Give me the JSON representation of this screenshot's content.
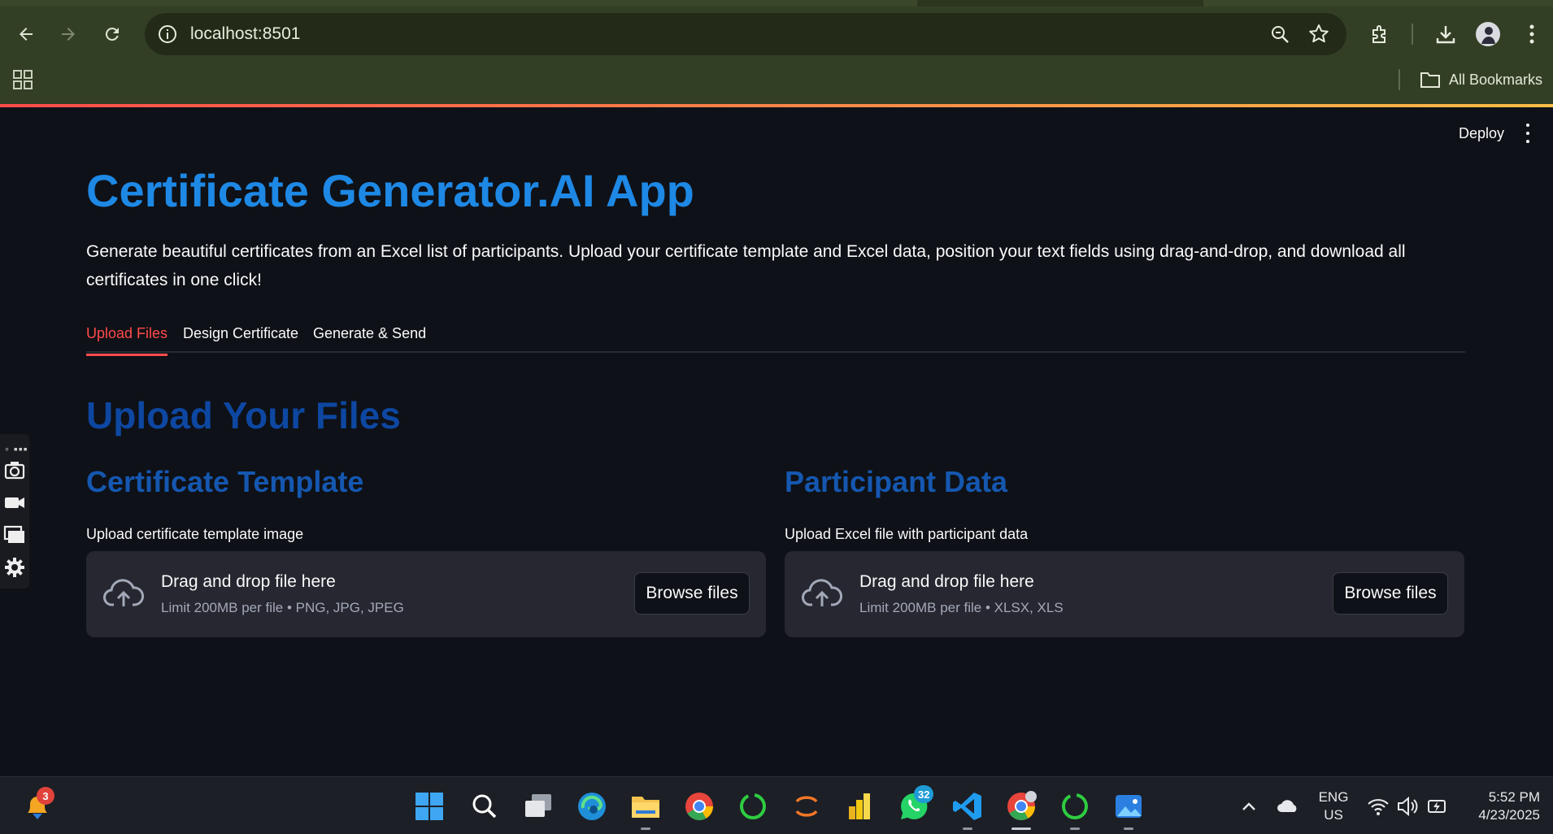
{
  "browser": {
    "url": "localhost:8501",
    "bookmarks_label": "All Bookmarks"
  },
  "app": {
    "deploy_label": "Deploy",
    "title": "Certificate Generator.AI App",
    "description": "Generate beautiful certificates from an Excel list of participants. Upload your certificate template and Excel data, position your text fields using drag-and-drop, and download all certificates in one click!",
    "tabs": [
      {
        "label": "Upload Files",
        "active": true
      },
      {
        "label": "Design Certificate",
        "active": false
      },
      {
        "label": "Generate & Send",
        "active": false
      }
    ],
    "section_title": "Upload Your Files",
    "template": {
      "heading": "Certificate Template",
      "label": "Upload certificate template image",
      "drop_title": "Drag and drop file here",
      "drop_limit": "Limit 200MB per file • PNG, JPG, JPEG",
      "browse_label": "Browse files"
    },
    "participants": {
      "heading": "Participant Data",
      "label": "Upload Excel file with participant data",
      "drop_title": "Drag and drop file here",
      "drop_limit": "Limit 200MB per file • XLSX, XLS",
      "browse_label": "Browse files"
    },
    "colors": {
      "title": "#1e88e5",
      "section_title": "#0d47a1",
      "subheading": "#1557b0",
      "active_tab": "#ff4b4b",
      "background": "#0e1117"
    }
  },
  "taskbar": {
    "notification_badge": "3",
    "whatsapp_badge": "32",
    "language": "ENG",
    "region": "US",
    "time": "5:52 PM",
    "date": "4/23/2025"
  }
}
